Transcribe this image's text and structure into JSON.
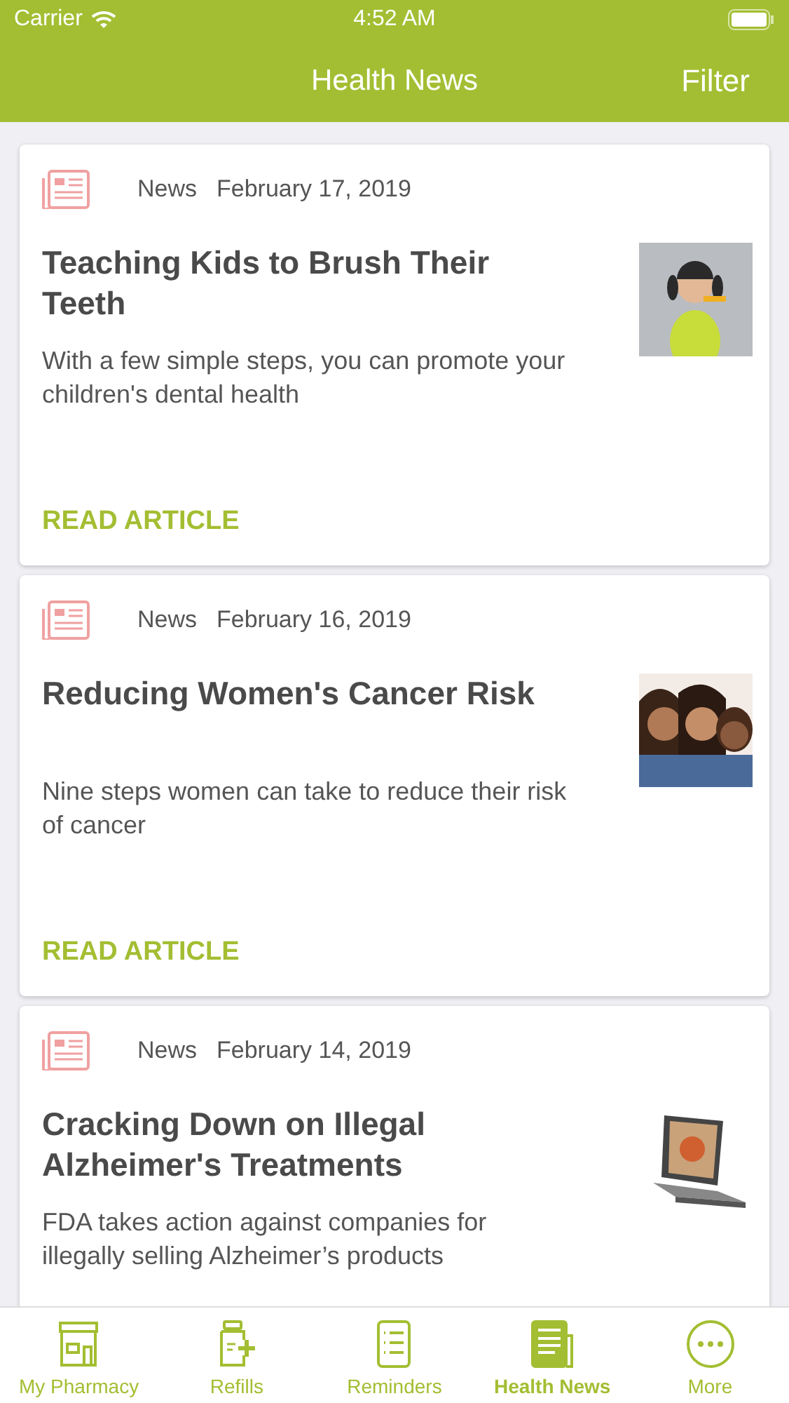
{
  "status_bar": {
    "carrier": "Carrier",
    "time": "4:52 AM"
  },
  "nav_bar": {
    "title": "Health News",
    "action": "Filter"
  },
  "articles": [
    {
      "category": "News",
      "date": "February 17, 2019",
      "title": "Teaching Kids to Brush Their Teeth",
      "summary": "With a few simple steps, you can promote your children's dental health",
      "link": "READ ARTICLE"
    },
    {
      "category": "News",
      "date": "February 16, 2019",
      "title": "Reducing Women's Cancer Risk",
      "summary": "Nine steps women can take to reduce their risk of cancer",
      "link": "READ ARTICLE"
    },
    {
      "category": "News",
      "date": "February 14, 2019",
      "title": "Cracking Down on Illegal Alzheimer's Treatments",
      "summary": "FDA takes action against companies for illegally selling Alzheimer’s products"
    }
  ],
  "tab_bar": [
    {
      "kind": "store",
      "label": "My Pharmacy",
      "selected": false
    },
    {
      "kind": "refills",
      "label": "Refills",
      "selected": false
    },
    {
      "kind": "list",
      "label": "Reminders",
      "selected": false
    },
    {
      "kind": "news",
      "label": "Health News",
      "selected": true
    },
    {
      "kind": "more",
      "label": "More",
      "selected": false
    }
  ]
}
